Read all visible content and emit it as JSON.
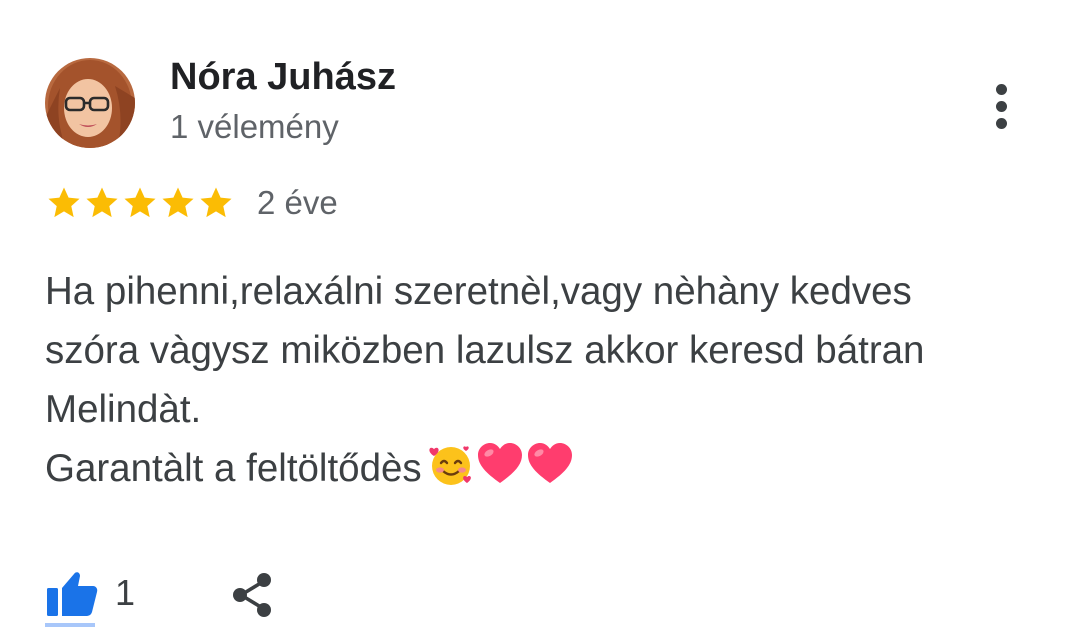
{
  "reviewer": {
    "name": "Nóra Juhász",
    "review_count": "1 vélemény",
    "avatar_icon": "profile-photo"
  },
  "review": {
    "rating": 5,
    "rating_max": 5,
    "date": "2 éve",
    "text_lines": [
      "Ha pihenni,relaxálni szeretnèl,vagy nèhàny kedves",
      "szóra vàgysz miközben lazulsz akkor keresd bátran",
      "Melindàt.",
      "Garantàlt a feltöltődès"
    ],
    "emojis": [
      "smiling-face-with-hearts",
      "red-heart",
      "red-heart"
    ]
  },
  "actions": {
    "like_count": "1",
    "like_icon": "thumbs-up-icon",
    "share_icon": "share-icon",
    "more_icon": "more-vert-icon"
  },
  "colors": {
    "star": "#fbbc04",
    "accent": "#1a73e8",
    "text_primary": "#202124",
    "text_secondary": "#5f6368",
    "heart": "#ff3d6e"
  }
}
